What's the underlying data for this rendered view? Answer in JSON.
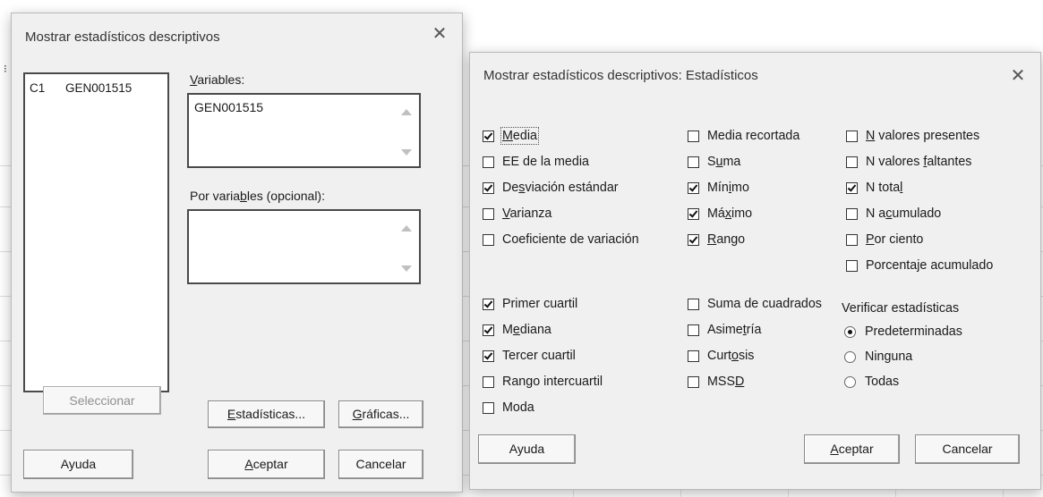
{
  "main_dialog": {
    "title": "Mostrar estadísticos descriptivos",
    "close_glyph": "✕",
    "column_list": [
      {
        "col": "C1",
        "name": "GEN001515"
      }
    ],
    "variables_label_pre": "",
    "variables_label_u": "V",
    "variables_label_post": "ariables:",
    "variables_value": "GEN001515",
    "by_label_pre": "Por varia",
    "by_label_u": "b",
    "by_label_post": "les (opcional):",
    "by_value": "",
    "buttons": {
      "select": "Seleccionar",
      "stats_u": "E",
      "stats_rest": "stadísticas...",
      "graphs_u": "G",
      "graphs_rest": "ráficas...",
      "help": "Ayuda",
      "ok_u": "A",
      "ok_rest": "ceptar",
      "cancel": "Cancelar"
    }
  },
  "stats_dialog": {
    "title": "Mostrar estadísticos descriptivos: Estadísticos",
    "close_glyph": "✕",
    "col1": [
      {
        "pre": "",
        "u": "M",
        "post": "edia",
        "checked": true
      },
      {
        "pre": "EE de la media",
        "u": "",
        "post": "",
        "checked": false
      },
      {
        "pre": "De",
        "u": "s",
        "post": "viación estándar",
        "checked": true
      },
      {
        "pre": "",
        "u": "V",
        "post": "arianza",
        "checked": false
      },
      {
        "pre": "Coeficiente de variación",
        "u": "",
        "post": "",
        "checked": false
      }
    ],
    "col2": [
      {
        "pre": "Media recortada",
        "u": "",
        "post": "",
        "checked": false
      },
      {
        "pre": "S",
        "u": "u",
        "post": "ma",
        "checked": false
      },
      {
        "pre": "Mín",
        "u": "i",
        "post": "mo",
        "checked": true
      },
      {
        "pre": "Má",
        "u": "x",
        "post": "imo",
        "checked": true
      },
      {
        "pre": "",
        "u": "R",
        "post": "ango",
        "checked": true
      }
    ],
    "col3": [
      {
        "pre": "",
        "u": "N",
        "post": " valores presentes",
        "checked": false
      },
      {
        "pre": "N valores ",
        "u": "f",
        "post": "altantes",
        "checked": false
      },
      {
        "pre": "N tota",
        "u": "l",
        "post": "",
        "checked": true
      },
      {
        "pre": "N a",
        "u": "c",
        "post": "umulado",
        "checked": false
      },
      {
        "pre": "",
        "u": "P",
        "post": "or ciento",
        "checked": false
      },
      {
        "pre": "Porcenta",
        "u": "j",
        "post": "e acumulado",
        "checked": false
      }
    ],
    "col1b": [
      {
        "pre": "Primer cuartil",
        "u": "",
        "post": "",
        "checked": true
      },
      {
        "pre": "M",
        "u": "e",
        "post": "diana",
        "checked": true
      },
      {
        "pre": "Tercer cuartil",
        "u": "",
        "post": "",
        "checked": true
      },
      {
        "pre": "Ran",
        "u": "g",
        "post": "o intercuartil",
        "checked": false
      },
      {
        "pre": "Moda",
        "u": "",
        "post": "",
        "checked": false
      }
    ],
    "col2b": [
      {
        "pre": "Suma de cuadrados",
        "u": "",
        "post": "",
        "checked": false
      },
      {
        "pre": "Asime",
        "u": "t",
        "post": "ría",
        "checked": false
      },
      {
        "pre": "Curt",
        "u": "o",
        "post": "sis",
        "checked": false
      },
      {
        "pre": "MSS",
        "u": "D",
        "post": "",
        "checked": false
      }
    ],
    "verify_label": "Verificar estadísticas",
    "radios": [
      {
        "label": "Predeterminadas",
        "selected": true
      },
      {
        "label": "Ninguna",
        "selected": false
      },
      {
        "label": "Todas",
        "selected": false
      }
    ],
    "buttons": {
      "help": "Ayuda",
      "ok_u": "A",
      "ok_rest": "ceptar",
      "cancel": "Cancelar"
    }
  }
}
